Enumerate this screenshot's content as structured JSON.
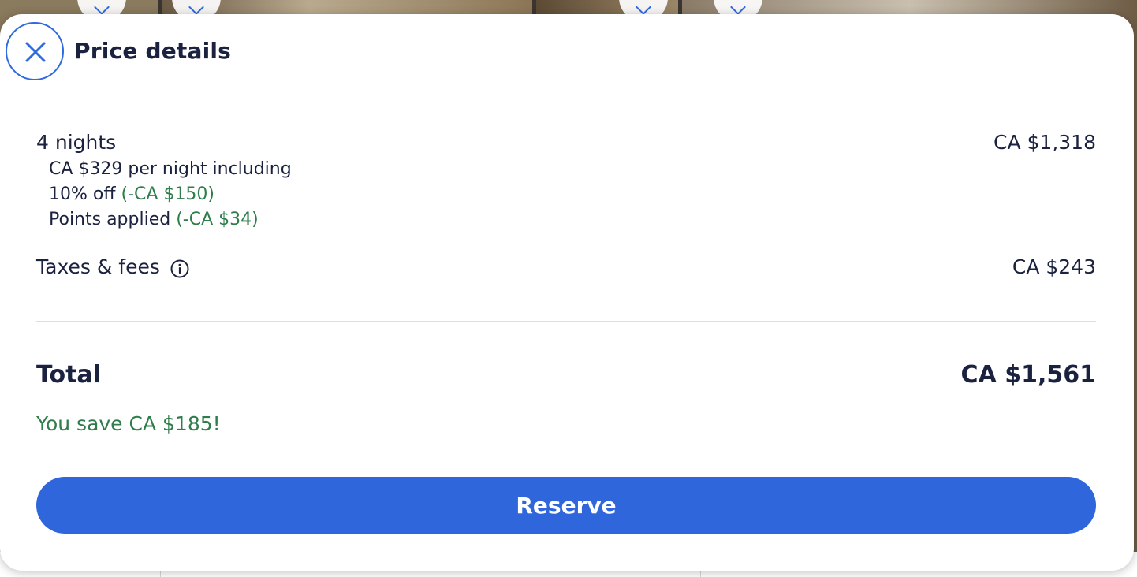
{
  "dialog": {
    "title": "Price details",
    "close_icon": "close-icon"
  },
  "nights": {
    "label": "4 nights",
    "amount": "CA $1,318",
    "per_night": "CA $329 per night including",
    "discount_label": "10% off",
    "discount_value": "(-CA $150)",
    "points_label": "Points applied",
    "points_value": "(-CA $34)"
  },
  "taxes": {
    "label": "Taxes & fees",
    "amount": "CA $243",
    "info_icon": "info-icon"
  },
  "total": {
    "label": "Total",
    "amount": "CA $1,561",
    "savings": "You save CA $185!"
  },
  "actions": {
    "reserve_label": "Reserve"
  },
  "colors": {
    "primary": "#2f66dc",
    "savings_green": "#2e7d4a",
    "text": "#1b2240"
  }
}
